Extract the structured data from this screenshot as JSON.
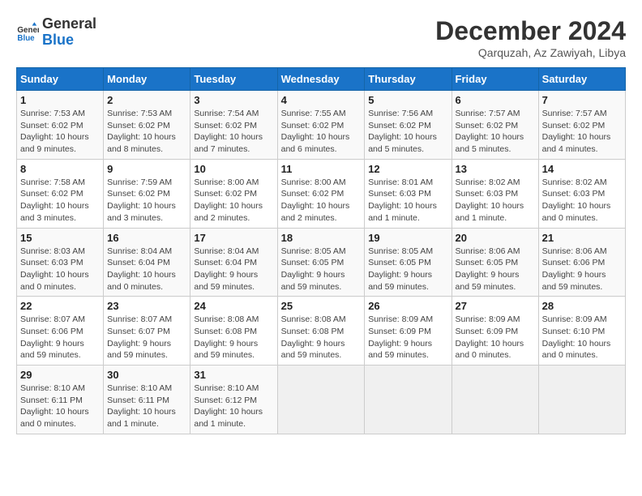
{
  "logo": {
    "line1": "General",
    "line2": "Blue"
  },
  "title": "December 2024",
  "location": "Qarquzah, Az Zawiyah, Libya",
  "days_of_week": [
    "Sunday",
    "Monday",
    "Tuesday",
    "Wednesday",
    "Thursday",
    "Friday",
    "Saturday"
  ],
  "weeks": [
    [
      {
        "day": "1",
        "info": "Sunrise: 7:53 AM\nSunset: 6:02 PM\nDaylight: 10 hours and 9 minutes."
      },
      {
        "day": "2",
        "info": "Sunrise: 7:53 AM\nSunset: 6:02 PM\nDaylight: 10 hours and 8 minutes."
      },
      {
        "day": "3",
        "info": "Sunrise: 7:54 AM\nSunset: 6:02 PM\nDaylight: 10 hours and 7 minutes."
      },
      {
        "day": "4",
        "info": "Sunrise: 7:55 AM\nSunset: 6:02 PM\nDaylight: 10 hours and 6 minutes."
      },
      {
        "day": "5",
        "info": "Sunrise: 7:56 AM\nSunset: 6:02 PM\nDaylight: 10 hours and 5 minutes."
      },
      {
        "day": "6",
        "info": "Sunrise: 7:57 AM\nSunset: 6:02 PM\nDaylight: 10 hours and 5 minutes."
      },
      {
        "day": "7",
        "info": "Sunrise: 7:57 AM\nSunset: 6:02 PM\nDaylight: 10 hours and 4 minutes."
      }
    ],
    [
      {
        "day": "8",
        "info": "Sunrise: 7:58 AM\nSunset: 6:02 PM\nDaylight: 10 hours and 3 minutes."
      },
      {
        "day": "9",
        "info": "Sunrise: 7:59 AM\nSunset: 6:02 PM\nDaylight: 10 hours and 3 minutes."
      },
      {
        "day": "10",
        "info": "Sunrise: 8:00 AM\nSunset: 6:02 PM\nDaylight: 10 hours and 2 minutes."
      },
      {
        "day": "11",
        "info": "Sunrise: 8:00 AM\nSunset: 6:02 PM\nDaylight: 10 hours and 2 minutes."
      },
      {
        "day": "12",
        "info": "Sunrise: 8:01 AM\nSunset: 6:03 PM\nDaylight: 10 hours and 1 minute."
      },
      {
        "day": "13",
        "info": "Sunrise: 8:02 AM\nSunset: 6:03 PM\nDaylight: 10 hours and 1 minute."
      },
      {
        "day": "14",
        "info": "Sunrise: 8:02 AM\nSunset: 6:03 PM\nDaylight: 10 hours and 0 minutes."
      }
    ],
    [
      {
        "day": "15",
        "info": "Sunrise: 8:03 AM\nSunset: 6:03 PM\nDaylight: 10 hours and 0 minutes."
      },
      {
        "day": "16",
        "info": "Sunrise: 8:04 AM\nSunset: 6:04 PM\nDaylight: 10 hours and 0 minutes."
      },
      {
        "day": "17",
        "info": "Sunrise: 8:04 AM\nSunset: 6:04 PM\nDaylight: 9 hours and 59 minutes."
      },
      {
        "day": "18",
        "info": "Sunrise: 8:05 AM\nSunset: 6:05 PM\nDaylight: 9 hours and 59 minutes."
      },
      {
        "day": "19",
        "info": "Sunrise: 8:05 AM\nSunset: 6:05 PM\nDaylight: 9 hours and 59 minutes."
      },
      {
        "day": "20",
        "info": "Sunrise: 8:06 AM\nSunset: 6:05 PM\nDaylight: 9 hours and 59 minutes."
      },
      {
        "day": "21",
        "info": "Sunrise: 8:06 AM\nSunset: 6:06 PM\nDaylight: 9 hours and 59 minutes."
      }
    ],
    [
      {
        "day": "22",
        "info": "Sunrise: 8:07 AM\nSunset: 6:06 PM\nDaylight: 9 hours and 59 minutes."
      },
      {
        "day": "23",
        "info": "Sunrise: 8:07 AM\nSunset: 6:07 PM\nDaylight: 9 hours and 59 minutes."
      },
      {
        "day": "24",
        "info": "Sunrise: 8:08 AM\nSunset: 6:08 PM\nDaylight: 9 hours and 59 minutes."
      },
      {
        "day": "25",
        "info": "Sunrise: 8:08 AM\nSunset: 6:08 PM\nDaylight: 9 hours and 59 minutes."
      },
      {
        "day": "26",
        "info": "Sunrise: 8:09 AM\nSunset: 6:09 PM\nDaylight: 9 hours and 59 minutes."
      },
      {
        "day": "27",
        "info": "Sunrise: 8:09 AM\nSunset: 6:09 PM\nDaylight: 10 hours and 0 minutes."
      },
      {
        "day": "28",
        "info": "Sunrise: 8:09 AM\nSunset: 6:10 PM\nDaylight: 10 hours and 0 minutes."
      }
    ],
    [
      {
        "day": "29",
        "info": "Sunrise: 8:10 AM\nSunset: 6:11 PM\nDaylight: 10 hours and 0 minutes."
      },
      {
        "day": "30",
        "info": "Sunrise: 8:10 AM\nSunset: 6:11 PM\nDaylight: 10 hours and 1 minute."
      },
      {
        "day": "31",
        "info": "Sunrise: 8:10 AM\nSunset: 6:12 PM\nDaylight: 10 hours and 1 minute."
      },
      null,
      null,
      null,
      null
    ]
  ]
}
